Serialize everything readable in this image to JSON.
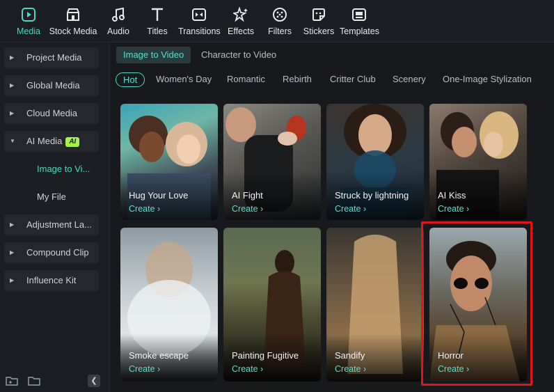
{
  "toolbar": {
    "items": [
      {
        "label": "Media",
        "icon": "media-icon",
        "active": true
      },
      {
        "label": "Stock Media",
        "icon": "stock-media-icon"
      },
      {
        "label": "Audio",
        "icon": "music-note-icon"
      },
      {
        "label": "Titles",
        "icon": "text-t-icon"
      },
      {
        "label": "Transitions",
        "icon": "transitions-icon"
      },
      {
        "label": "Effects",
        "icon": "effects-star-icon"
      },
      {
        "label": "Filters",
        "icon": "filters-icon"
      },
      {
        "label": "Stickers",
        "icon": "stickers-icon"
      },
      {
        "label": "Templates",
        "icon": "templates-icon"
      }
    ]
  },
  "sidebar": {
    "items": [
      {
        "label": "Project Media"
      },
      {
        "label": "Global Media"
      },
      {
        "label": "Cloud Media"
      },
      {
        "label": "AI Media",
        "badge": "AI",
        "expanded": true
      },
      {
        "label": "Adjustment La..."
      },
      {
        "label": "Compound Clip"
      },
      {
        "label": "Influence Kit"
      }
    ],
    "sub_items": [
      {
        "label": "Image to Vi...",
        "active": true
      },
      {
        "label": "My File"
      }
    ]
  },
  "mode_tabs": [
    {
      "label": "Image to Video",
      "active": true
    },
    {
      "label": "Character to Video"
    }
  ],
  "categories": [
    {
      "label": "Hot",
      "active": true
    },
    {
      "label": "Women's Day"
    },
    {
      "label": "Romantic"
    },
    {
      "label": "Rebirth"
    },
    {
      "label": "Critter Club"
    },
    {
      "label": "Scenery"
    },
    {
      "label": "One-Image Stylization"
    }
  ],
  "cards": [
    {
      "title": "Hug Your Love",
      "action": "Create"
    },
    {
      "title": "AI Fight",
      "action": "Create"
    },
    {
      "title": "Struck by lightning",
      "action": "Create"
    },
    {
      "title": "AI Kiss",
      "action": "Create"
    },
    {
      "title": "Smoke escape",
      "action": "Create"
    },
    {
      "title": "Painting Fugitive",
      "action": "Create"
    },
    {
      "title": "Sandify",
      "action": "Create"
    },
    {
      "title": "Horror",
      "action": "Create"
    }
  ],
  "colors": {
    "accent": "#4fd8c0",
    "highlight_box": "#e0141b",
    "ai_badge": "#a8f04a"
  }
}
